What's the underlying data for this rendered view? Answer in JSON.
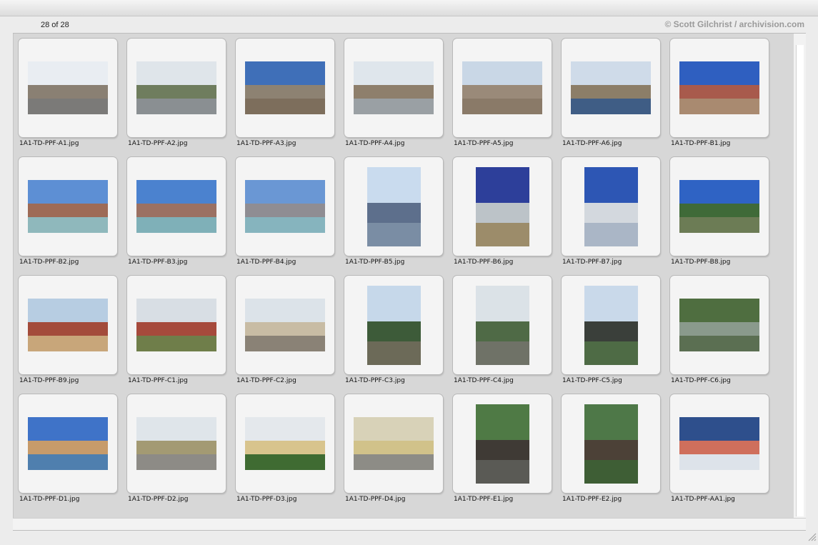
{
  "header": {
    "count_label": "28 of 28",
    "credit": "© Scott Gilchrist / archivision.com"
  },
  "colors": {
    "panel": "#d7d7d7",
    "slide": "#f4f4f4",
    "credit_text": "#9a9a9a"
  },
  "icons": {
    "resize": "resize-grip-icon"
  },
  "thumbnails": [
    {
      "name": "1A1-TD-PPF-A1.jpg",
      "orient": "landscape",
      "sky": "#e9edf2",
      "mid": "#8a8073",
      "ground": "#7b7a78"
    },
    {
      "name": "1A1-TD-PPF-A2.jpg",
      "orient": "landscape",
      "sky": "#dfe5ea",
      "mid": "#6f7d5e",
      "ground": "#8a8f92"
    },
    {
      "name": "1A1-TD-PPF-A3.jpg",
      "orient": "landscape",
      "sky": "#3f6fb8",
      "mid": "#8d8272",
      "ground": "#7d6e5c"
    },
    {
      "name": "1A1-TD-PPF-A4.jpg",
      "orient": "landscape",
      "sky": "#dfe6ec",
      "mid": "#8e7f6c",
      "ground": "#9aa0a4"
    },
    {
      "name": "1A1-TD-PPF-A5.jpg",
      "orient": "landscape",
      "sky": "#c9d7e6",
      "mid": "#9a8a79",
      "ground": "#8a7a68"
    },
    {
      "name": "1A1-TD-PPF-A6.jpg",
      "orient": "landscape",
      "sky": "#cfdbe9",
      "mid": "#8c7e68",
      "ground": "#3f5d85"
    },
    {
      "name": "1A1-TD-PPF-B1.jpg",
      "orient": "landscape",
      "sky": "#2f5fc0",
      "mid": "#a85a4c",
      "ground": "#a98a70"
    },
    {
      "name": "1A1-TD-PPF-B2.jpg",
      "orient": "landscape",
      "sky": "#5d8fd4",
      "mid": "#9e6b56",
      "ground": "#8fb8bc"
    },
    {
      "name": "1A1-TD-PPF-B3.jpg",
      "orient": "landscape",
      "sky": "#4b82cf",
      "mid": "#9b7163",
      "ground": "#7fb0b8"
    },
    {
      "name": "1A1-TD-PPF-B4.jpg",
      "orient": "landscape",
      "sky": "#6a97d4",
      "mid": "#8f8d93",
      "ground": "#86b4be"
    },
    {
      "name": "1A1-TD-PPF-B5.jpg",
      "orient": "portrait",
      "sky": "#c9dbee",
      "mid": "#5d6f8c",
      "ground": "#7a8da4"
    },
    {
      "name": "1A1-TD-PPF-B6.jpg",
      "orient": "portrait",
      "sky": "#2d3f9a",
      "mid": "#bcc3c8",
      "ground": "#9c8c6a"
    },
    {
      "name": "1A1-TD-PPF-B7.jpg",
      "orient": "portrait",
      "sky": "#2d56b4",
      "mid": "#d3d8de",
      "ground": "#aab6c6"
    },
    {
      "name": "1A1-TD-PPF-B8.jpg",
      "orient": "landscape",
      "sky": "#2f63c4",
      "mid": "#3f6a38",
      "ground": "#6c7c55"
    },
    {
      "name": "1A1-TD-PPF-B9.jpg",
      "orient": "landscape",
      "sky": "#b7cde2",
      "mid": "#a34b3b",
      "ground": "#c8a67a"
    },
    {
      "name": "1A1-TD-PPF-C1.jpg",
      "orient": "landscape",
      "sky": "#d8dee4",
      "mid": "#a64a3c",
      "ground": "#6f7e4a"
    },
    {
      "name": "1A1-TD-PPF-C2.jpg",
      "orient": "landscape",
      "sky": "#dce3e9",
      "mid": "#c8bca4",
      "ground": "#8a8276"
    },
    {
      "name": "1A1-TD-PPF-C3.jpg",
      "orient": "portrait",
      "sky": "#c6d8ea",
      "mid": "#3d5b39",
      "ground": "#6c6a58"
    },
    {
      "name": "1A1-TD-PPF-C4.jpg",
      "orient": "portrait",
      "sky": "#dbe2e7",
      "mid": "#4f6a46",
      "ground": "#6f7267"
    },
    {
      "name": "1A1-TD-PPF-C5.jpg",
      "orient": "portrait",
      "sky": "#c9d9ea",
      "mid": "#3a3f3a",
      "ground": "#4e6b45"
    },
    {
      "name": "1A1-TD-PPF-C6.jpg",
      "orient": "landscape",
      "sky": "#4f6e40",
      "mid": "#8a9a8c",
      "ground": "#5b6f52"
    },
    {
      "name": "1A1-TD-PPF-D1.jpg",
      "orient": "landscape",
      "sky": "#3f73c8",
      "mid": "#c79b6a",
      "ground": "#4f7fae"
    },
    {
      "name": "1A1-TD-PPF-D2.jpg",
      "orient": "landscape",
      "sky": "#dfe5ea",
      "mid": "#a39a73",
      "ground": "#8d8b86"
    },
    {
      "name": "1A1-TD-PPF-D3.jpg",
      "orient": "landscape",
      "sky": "#e4e8ec",
      "mid": "#d8c48d",
      "ground": "#3f6b32"
    },
    {
      "name": "1A1-TD-PPF-D4.jpg",
      "orient": "landscape",
      "sky": "#d8d2b8",
      "mid": "#d1c28a",
      "ground": "#8d8c86"
    },
    {
      "name": "1A1-TD-PPF-E1.jpg",
      "orient": "portrait",
      "sky": "#4f7a45",
      "mid": "#3f3a35",
      "ground": "#5a5a55"
    },
    {
      "name": "1A1-TD-PPF-E2.jpg",
      "orient": "portrait",
      "sky": "#4e7848",
      "mid": "#4c4137",
      "ground": "#3e5e35"
    },
    {
      "name": "1A1-TD-PPF-AA1.jpg",
      "orient": "landscape",
      "sky": "#2e4f8c",
      "mid": "#cf6f5c",
      "ground": "#dde3ea"
    }
  ]
}
